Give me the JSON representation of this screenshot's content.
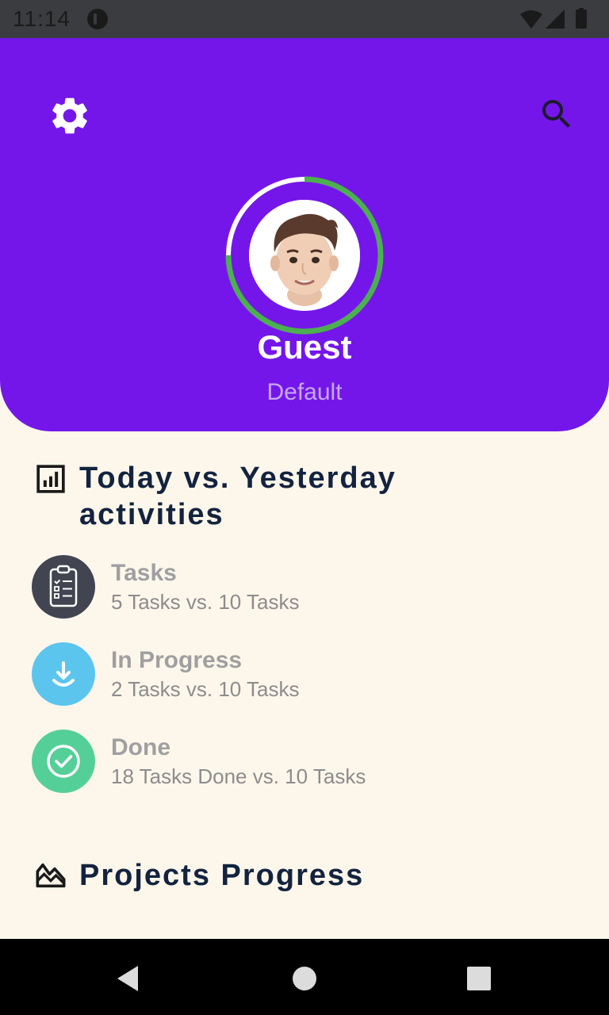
{
  "status_bar": {
    "time": "11:14",
    "icons": [
      "notification-icon",
      "wifi-icon",
      "signal-icon",
      "battery-icon"
    ]
  },
  "header": {
    "background": "#7416ea",
    "settings_icon": "gear-icon",
    "search_icon": "search-icon",
    "progress_ring_color": "#4caf50",
    "progress_fraction": 0.75
  },
  "user": {
    "name": "Guest",
    "role": "Default"
  },
  "activities_section": {
    "title_line1": "Today vs. Yesterday",
    "title_line2": "activities",
    "icon": "chart-icon",
    "items": [
      {
        "label": "Tasks",
        "detail": "5 Tasks vs. 10 Tasks",
        "icon": "clipboard-icon",
        "color": "#424451"
      },
      {
        "label": "In Progress",
        "detail": "2 Tasks vs. 10 Tasks",
        "icon": "download-icon",
        "color": "#5bc5ee"
      },
      {
        "label": "Done",
        "detail": "18 Tasks Done vs. 10 Tasks",
        "icon": "check-circle-icon",
        "color": "#55cf98"
      }
    ]
  },
  "projects_section": {
    "title": "Projects Progress",
    "icon": "landscape-icon"
  },
  "nav_bar": {
    "buttons": [
      "back-icon",
      "home-icon",
      "recents-icon"
    ]
  }
}
